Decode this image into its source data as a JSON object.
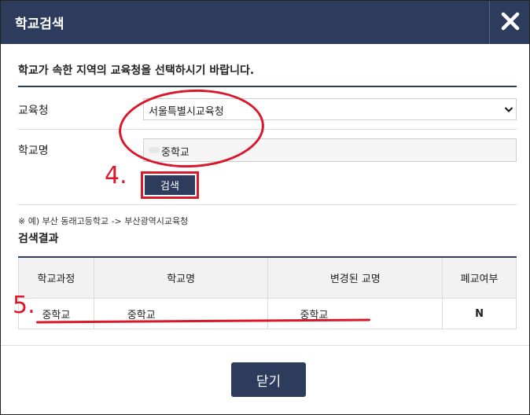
{
  "dialog": {
    "title": "학교검색",
    "instruction": "학교가 속한 지역의 교육청을 선택하시기 바랍니다."
  },
  "form": {
    "office_label": "교육청",
    "office_selected": "서울특별시교육청",
    "school_label": "학교명",
    "school_value": "중학교",
    "search_button": "검색"
  },
  "annotations": {
    "step4": "4.",
    "step5": "5."
  },
  "example_hint": "※ 예) 부산 동래고등학교 -> 부산광역시교육청",
  "results": {
    "title": "검색결과",
    "columns": [
      "학교과정",
      "학교명",
      "변경된 교명",
      "폐교여부"
    ],
    "rows": [
      {
        "course": "중학교",
        "name": "중학교",
        "changed_name": "중학교",
        "closed": "N"
      }
    ]
  },
  "footer": {
    "close_button": "닫기"
  },
  "colors": {
    "header": "#2d3b5d",
    "annotation_red": "#d9182b"
  }
}
